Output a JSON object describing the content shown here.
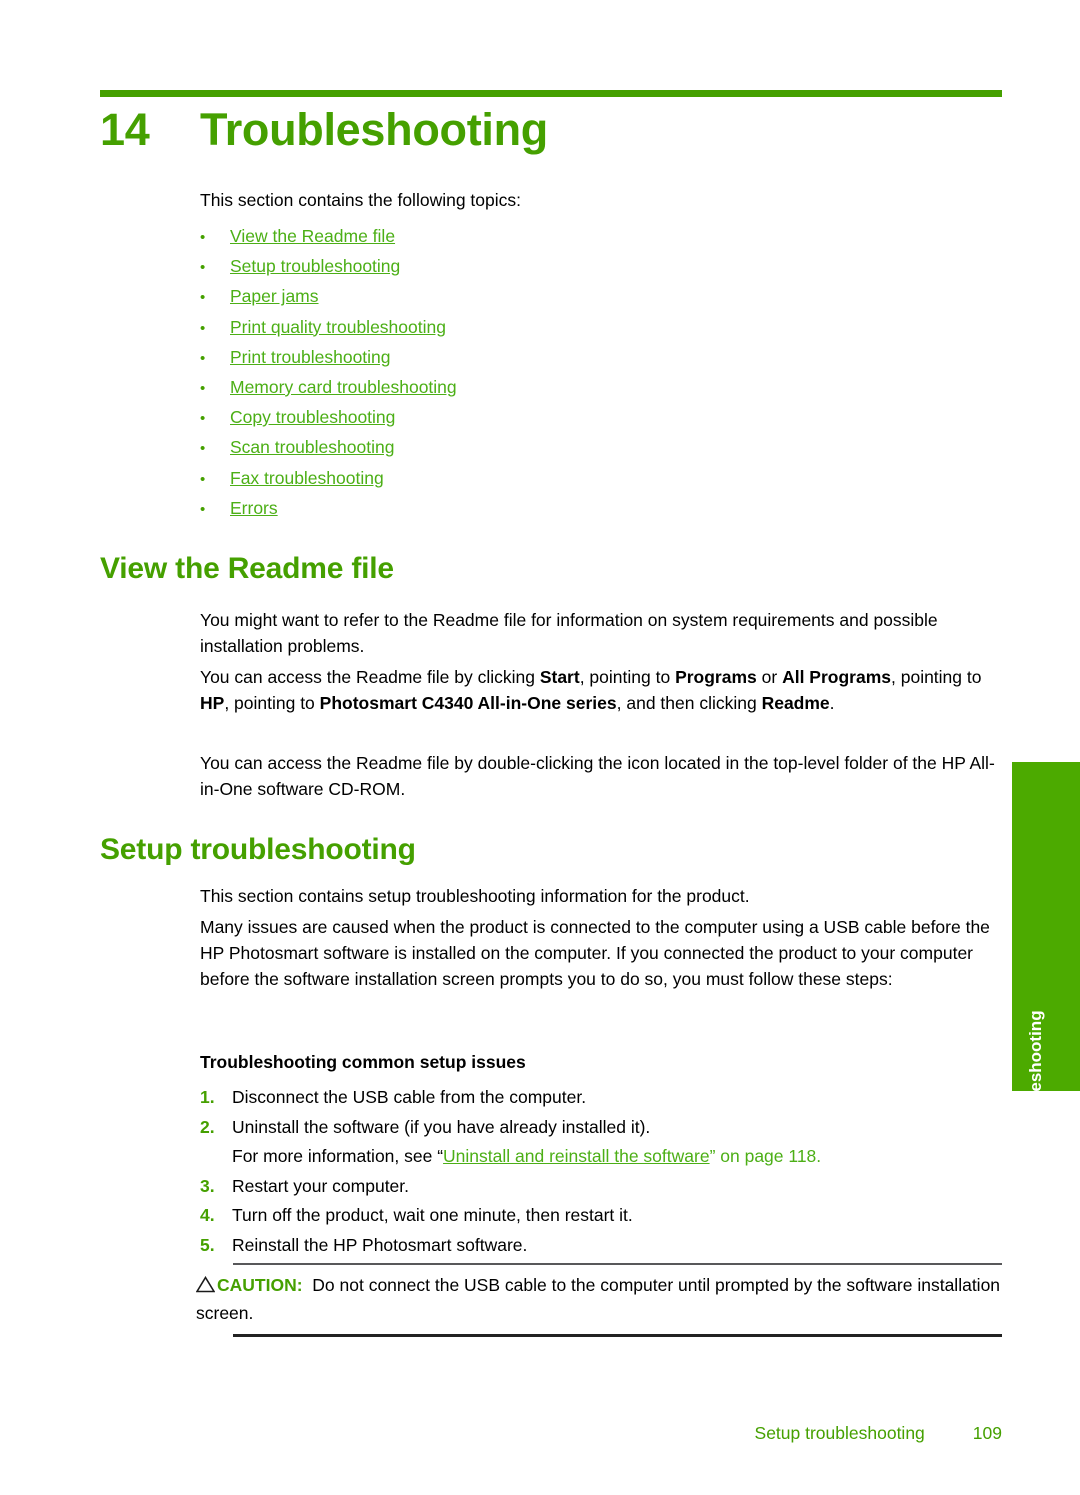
{
  "chapter": {
    "number": "14",
    "title": "Troubleshooting"
  },
  "intro": "This section contains the following topics:",
  "toc": {
    "bullet": "•",
    "items": [
      {
        "label": "View the Readme file"
      },
      {
        "label": "Setup troubleshooting"
      },
      {
        "label": "Paper jams"
      },
      {
        "label": "Print quality troubleshooting"
      },
      {
        "label": "Print troubleshooting"
      },
      {
        "label": "Memory card troubleshooting"
      },
      {
        "label": "Copy troubleshooting"
      },
      {
        "label": "Scan troubleshooting"
      },
      {
        "label": "Fax troubleshooting"
      },
      {
        "label": "Errors"
      }
    ]
  },
  "sections": {
    "readme": {
      "heading": "View the Readme file",
      "p1": "You might want to refer to the Readme file for information on system requirements and possible installation problems.",
      "p2": {
        "t1": "You can access the Readme file by clicking ",
        "b1": "Start",
        "t2": ", pointing to ",
        "b2": "Programs",
        "t3": " or ",
        "b3": "All Programs",
        "t4": ", pointing to ",
        "b4": "HP",
        "t5": ", pointing to ",
        "b5": "Photosmart C4340 All-in-One series",
        "t6": ", and then clicking ",
        "b6": "Readme",
        "t7": "."
      },
      "p3": "You can access the Readme file by double-clicking the icon located in the top-level folder of the HP All-in-One software CD-ROM."
    },
    "setup": {
      "heading": "Setup troubleshooting",
      "p1": "This section contains setup troubleshooting information for the product.",
      "p2": "Many issues are caused when the product is connected to the computer using a USB cable before the HP Photosmart software is installed on the computer. If you connected the product to your computer before the software installation screen prompts you to do so, you must follow these steps:",
      "subheading": "Troubleshooting common setup issues",
      "steps": [
        {
          "num": "1.",
          "text": "Disconnect the USB cable from the computer."
        },
        {
          "num": "2.",
          "text": "Uninstall the software (if you have already installed it).",
          "sub_prefix": "For more information, see “",
          "sub_link": "Uninstall and reinstall the software",
          "sub_suffix": "” on page 118."
        },
        {
          "num": "3.",
          "text": "Restart your computer."
        },
        {
          "num": "4.",
          "text": "Turn off the product, wait one minute, then restart it."
        },
        {
          "num": "5.",
          "text": "Reinstall the HP Photosmart software."
        }
      ],
      "caution": {
        "icon": "warning-triangle",
        "label": "CAUTION:",
        "text": "Do not connect the USB cable to the computer until prompted by the software installation screen."
      }
    }
  },
  "side_tab": {
    "label": "Troubleshooting"
  },
  "footer": {
    "section": "Setup troubleshooting",
    "page": "109"
  },
  "colors": {
    "heading_green": "#45a000",
    "link_green": "#4caf16",
    "tab_green": "#4caa00",
    "rule_gray": "#58585a"
  }
}
